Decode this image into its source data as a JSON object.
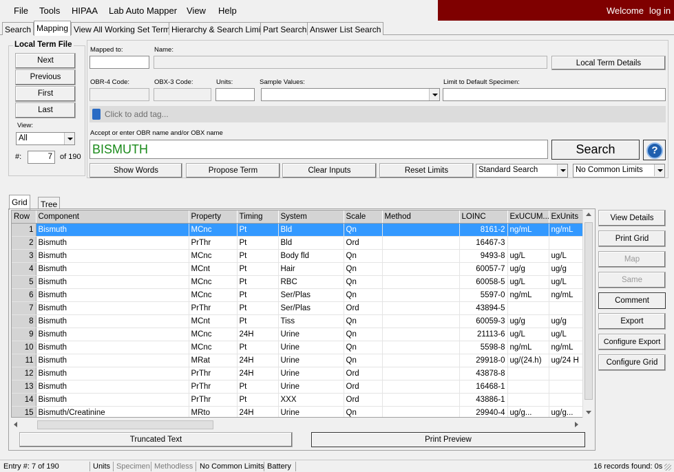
{
  "menu": [
    "File",
    "Tools",
    "HIPAA",
    "Lab Auto Mapper",
    "View",
    "Help"
  ],
  "welcome": {
    "text": "Welcome",
    "login": "log in"
  },
  "tabs": [
    "Search",
    "Mapping",
    "View All Working Set Terms",
    "Hierarchy & Search Limits",
    "Part Search",
    "Answer List Search"
  ],
  "local_term_file": {
    "title": "Local Term File",
    "buttons": [
      "Next",
      "Previous",
      "First",
      "Last"
    ],
    "view_label": "View:",
    "view_value": "All",
    "entry_label": "#:",
    "entry_value": "7",
    "entry_total": "of 190"
  },
  "fields": {
    "mapped_to": "Mapped to:",
    "name": "Name:",
    "local_term_details": "Local Term Details",
    "obr4": "OBR-4 Code:",
    "obx3": "OBX-3 Code:",
    "units": "Units:",
    "sample_values": "Sample Values:",
    "limit_specimen": "Limit to Default Specimen:",
    "tag_placeholder": "Click to add tag...",
    "accept_label": "Accept or enter OBR name and/or OBX name",
    "search_value": "BISMUTH",
    "search_button": "Search",
    "help_icon_text": "?"
  },
  "actions": [
    "Show Words",
    "Propose Term",
    "Clear Inputs",
    "Reset Limits"
  ],
  "search_mode": "Standard Search",
  "common_limits": "No Common Limits",
  "view_tabs": [
    "Grid",
    "Tree"
  ],
  "grid": {
    "columns": [
      "Row",
      "Component",
      "Property",
      "Timing",
      "System",
      "Scale",
      "Method",
      "LOINC",
      "ExUCUM...",
      "ExUnits"
    ],
    "rows": [
      [
        "1",
        "Bismuth",
        "MCnc",
        "Pt",
        "Bld",
        "Qn",
        "",
        "8161-2",
        "ng/mL",
        "ng/mL"
      ],
      [
        "2",
        "Bismuth",
        "PrThr",
        "Pt",
        "Bld",
        "Ord",
        "",
        "16467-3",
        "",
        ""
      ],
      [
        "3",
        "Bismuth",
        "MCnc",
        "Pt",
        "Body fld",
        "Qn",
        "",
        "9493-8",
        "ug/L",
        "ug/L"
      ],
      [
        "4",
        "Bismuth",
        "MCnt",
        "Pt",
        "Hair",
        "Qn",
        "",
        "60057-7",
        "ug/g",
        "ug/g"
      ],
      [
        "5",
        "Bismuth",
        "MCnc",
        "Pt",
        "RBC",
        "Qn",
        "",
        "60058-5",
        "ug/L",
        "ug/L"
      ],
      [
        "6",
        "Bismuth",
        "MCnc",
        "Pt",
        "Ser/Plas",
        "Qn",
        "",
        "5597-0",
        "ng/mL",
        "ng/mL"
      ],
      [
        "7",
        "Bismuth",
        "PrThr",
        "Pt",
        "Ser/Plas",
        "Ord",
        "",
        "43894-5",
        "",
        ""
      ],
      [
        "8",
        "Bismuth",
        "MCnt",
        "Pt",
        "Tiss",
        "Qn",
        "",
        "60059-3",
        "ug/g",
        "ug/g"
      ],
      [
        "9",
        "Bismuth",
        "MCnc",
        "24H",
        "Urine",
        "Qn",
        "",
        "21113-6",
        "ug/L",
        "ug/L"
      ],
      [
        "10",
        "Bismuth",
        "MCnc",
        "Pt",
        "Urine",
        "Qn",
        "",
        "5598-8",
        "ng/mL",
        "ng/mL"
      ],
      [
        "11",
        "Bismuth",
        "MRat",
        "24H",
        "Urine",
        "Qn",
        "",
        "29918-0",
        "ug/(24.h)",
        "ug/24 H"
      ],
      [
        "12",
        "Bismuth",
        "PrThr",
        "24H",
        "Urine",
        "Ord",
        "",
        "43878-8",
        "",
        ""
      ],
      [
        "13",
        "Bismuth",
        "PrThr",
        "Pt",
        "Urine",
        "Ord",
        "",
        "16468-1",
        "",
        ""
      ],
      [
        "14",
        "Bismuth",
        "PrThr",
        "Pt",
        "XXX",
        "Ord",
        "",
        "43886-1",
        "",
        ""
      ],
      [
        "15",
        "Bismuth/Creatinine",
        "MRto",
        "24H",
        "Urine",
        "Qn",
        "",
        "29940-4",
        "ug/g...",
        "ug/g..."
      ]
    ]
  },
  "side_buttons": [
    {
      "label": "View Details",
      "enabled": true
    },
    {
      "label": "Print Grid",
      "enabled": true
    },
    {
      "label": "Map",
      "enabled": false
    },
    {
      "label": "Same",
      "enabled": false
    },
    {
      "label": "Comment",
      "enabled": true
    },
    {
      "label": "Export",
      "enabled": true
    },
    {
      "label": "Configure Export",
      "enabled": true
    },
    {
      "label": "Configure Grid",
      "enabled": true
    }
  ],
  "bottom_buttons": [
    "Truncated Text",
    "Print Preview"
  ],
  "status": {
    "entry": "Entry #: 7 of 190",
    "units": "Units",
    "specimen": "Specimen",
    "methodless": "Methodless",
    "common_limits": "No Common Limits",
    "battery": "Battery",
    "records": "16 records found: 0s"
  },
  "colors": {
    "welcome_bg": "#7f0000",
    "selected_row": "#3399ff",
    "search_text": "#1a8a1a",
    "help_icon": "#1f5fae"
  }
}
